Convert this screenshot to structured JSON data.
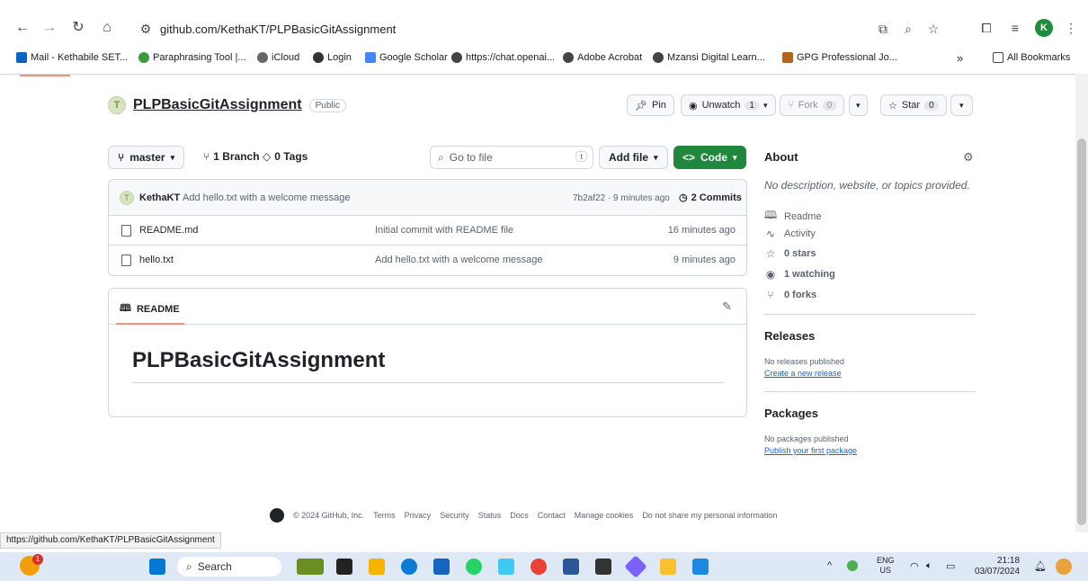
{
  "browser": {
    "url": "github.com/KethaKT/PLPBasicGitAssignment",
    "profile_initial": "K",
    "bookmarks": [
      {
        "label": "Mail - Kethabile SET...",
        "color": "#0a66c2"
      },
      {
        "label": "Paraphrasing Tool |...",
        "color": "#3c9a3c"
      },
      {
        "label": "iCloud",
        "color": "#666666"
      },
      {
        "label": "Login",
        "color": "#333333"
      },
      {
        "label": "Google Scholar",
        "color": "#4285f4"
      },
      {
        "label": "https://chat.openai...",
        "color": "#444444"
      },
      {
        "label": "Adobe Acrobat",
        "color": "#444444"
      },
      {
        "label": "Mzansi Digital Learn...",
        "color": "#444444"
      },
      {
        "label": "GPG Professional Jo...",
        "color": "#b5651d"
      }
    ],
    "more_label": "»",
    "all_bookmarks": "All Bookmarks",
    "status_url": "https://github.com/KethaKT/PLPBasicGitAssignment"
  },
  "repo": {
    "avatar_letter": "T",
    "name": "PLPBasicGitAssignment",
    "visibility": "Public",
    "pin": "Pin",
    "unwatch": "Unwatch",
    "unwatch_count": "1",
    "fork": "Fork",
    "fork_count": "0",
    "star": "Star",
    "star_count": "0"
  },
  "toolbar": {
    "branch": "master",
    "branches": "1 Branch",
    "tags": "0 Tags",
    "goto_placeholder": "Go to file",
    "goto_key": "t",
    "add_file": "Add file",
    "code": "Code"
  },
  "commit": {
    "author": "KethaKT",
    "message": "Add hello.txt with a welcome message",
    "hash_time": "7b2af22 · 9 minutes ago",
    "commits": "2 Commits"
  },
  "files": [
    {
      "name": "README.md",
      "message": "Initial commit with README file",
      "time": "16 minutes ago"
    },
    {
      "name": "hello.txt",
      "message": "Add hello.txt with a welcome message",
      "time": "9 minutes ago"
    }
  ],
  "readme": {
    "tab": "README",
    "title": "PLPBasicGitAssignment"
  },
  "about": {
    "heading": "About",
    "description": "No description, website, or topics provided.",
    "readme": "Readme",
    "activity": "Activity",
    "stars": "0 stars",
    "watching": "1 watching",
    "forks": "0 forks"
  },
  "releases": {
    "heading": "Releases",
    "sub": "No releases published",
    "link": "Create a new release"
  },
  "packages": {
    "heading": "Packages",
    "sub": "No packages published",
    "link": "Publish your first package"
  },
  "footer": {
    "copyright": "© 2024 GitHub, Inc.",
    "links": [
      "Terms",
      "Privacy",
      "Security",
      "Status",
      "Docs",
      "Contact",
      "Manage cookies",
      "Do not share my personal information"
    ]
  },
  "taskbar": {
    "notification_count": "1",
    "search": "Search",
    "lang_top": "ENG",
    "lang_bottom": "US",
    "time": "21:18",
    "date": "03/07/2024"
  }
}
